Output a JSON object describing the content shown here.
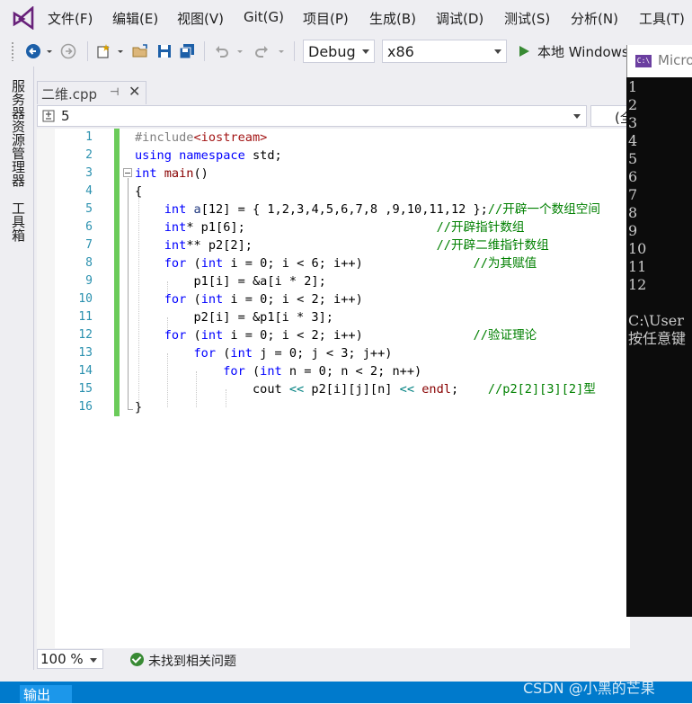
{
  "menubar": {
    "items": [
      "文件(F)",
      "编辑(E)",
      "视图(V)",
      "Git(G)",
      "项目(P)",
      "生成(B)",
      "调试(D)",
      "测试(S)",
      "分析(N)",
      "工具(T)"
    ]
  },
  "toolbar": {
    "configuration": "Debug",
    "platform": "x86",
    "run_label": "本地 Windows"
  },
  "side_tabs": [
    "服务器资源管理器",
    "工具箱"
  ],
  "tab": {
    "title": "二维.cpp",
    "pin": "⊣",
    "close": "✕"
  },
  "navbar": {
    "scope": "5",
    "member": "(全"
  },
  "editor": {
    "line_numbers": [
      "1",
      "2",
      "3",
      "4",
      "5",
      "6",
      "7",
      "8",
      "9",
      "10",
      "11",
      "12",
      "13",
      "14",
      "15",
      "16"
    ],
    "lines": [
      [
        {
          "t": "#include",
          "c": "pp"
        },
        {
          "t": "<iostream>",
          "c": "inc"
        }
      ],
      [
        {
          "t": "using",
          "c": "kw"
        },
        {
          "t": " ",
          "c": "pl"
        },
        {
          "t": "namespace",
          "c": "kw"
        },
        {
          "t": " std;",
          "c": "pl"
        }
      ],
      [
        {
          "t": "int",
          "c": "kw"
        },
        {
          "t": " ",
          "c": "pl"
        },
        {
          "t": "main",
          "c": "fn"
        },
        {
          "t": "()",
          "c": "pl"
        }
      ],
      [
        {
          "t": "{",
          "c": "pl"
        }
      ],
      [
        {
          "t": "    ",
          "c": "pl"
        },
        {
          "t": "int",
          "c": "kw"
        },
        {
          "t": " ",
          "c": "pl"
        },
        {
          "t": "a",
          "c": "var"
        },
        {
          "t": "[12] = { 1,2,3,4,5,6,7,8 ,9,10,11,12 };",
          "c": "pl"
        },
        {
          "t": "//开辟一个数组空间",
          "c": "cm"
        }
      ],
      [
        {
          "t": "    ",
          "c": "pl"
        },
        {
          "t": "int",
          "c": "kw"
        },
        {
          "t": "* p1[6];",
          "c": "pl"
        },
        {
          "t": "                          ",
          "c": "pl"
        },
        {
          "t": "//开辟指针数组",
          "c": "cm"
        }
      ],
      [
        {
          "t": "    ",
          "c": "pl"
        },
        {
          "t": "int",
          "c": "kw"
        },
        {
          "t": "** p2[2];",
          "c": "pl"
        },
        {
          "t": "                         ",
          "c": "pl"
        },
        {
          "t": "//开辟二维指针数组",
          "c": "cm"
        }
      ],
      [
        {
          "t": "    ",
          "c": "pl"
        },
        {
          "t": "for",
          "c": "kw"
        },
        {
          "t": " (",
          "c": "pl"
        },
        {
          "t": "int",
          "c": "kw"
        },
        {
          "t": " i = 0; i < 6; i++)",
          "c": "pl"
        },
        {
          "t": "               ",
          "c": "pl"
        },
        {
          "t": "//为其赋值",
          "c": "cm"
        }
      ],
      [
        {
          "t": "        p1[i] = &a[i * 2];",
          "c": "pl"
        }
      ],
      [
        {
          "t": "    ",
          "c": "pl"
        },
        {
          "t": "for",
          "c": "kw"
        },
        {
          "t": " (",
          "c": "pl"
        },
        {
          "t": "int",
          "c": "kw"
        },
        {
          "t": " i = 0; i < 2; i++)",
          "c": "pl"
        }
      ],
      [
        {
          "t": "        p2[i] = &p1[i * 3];",
          "c": "pl"
        }
      ],
      [
        {
          "t": "    ",
          "c": "pl"
        },
        {
          "t": "for",
          "c": "kw"
        },
        {
          "t": " (",
          "c": "pl"
        },
        {
          "t": "int",
          "c": "kw"
        },
        {
          "t": " i = 0; i < 2; i++)",
          "c": "pl"
        },
        {
          "t": "               ",
          "c": "pl"
        },
        {
          "t": "//验证理论",
          "c": "cm"
        }
      ],
      [
        {
          "t": "        ",
          "c": "pl"
        },
        {
          "t": "for",
          "c": "kw"
        },
        {
          "t": " (",
          "c": "pl"
        },
        {
          "t": "int",
          "c": "kw"
        },
        {
          "t": " j = 0; j < 3; j++)",
          "c": "pl"
        }
      ],
      [
        {
          "t": "            ",
          "c": "pl"
        },
        {
          "t": "for",
          "c": "kw"
        },
        {
          "t": " (",
          "c": "pl"
        },
        {
          "t": "int",
          "c": "kw"
        },
        {
          "t": " n = 0; n < 2; n++)",
          "c": "pl"
        }
      ],
      [
        {
          "t": "                cout ",
          "c": "pl"
        },
        {
          "t": "<<",
          "c": "op"
        },
        {
          "t": " p2[i][j][n] ",
          "c": "pl"
        },
        {
          "t": "<<",
          "c": "op"
        },
        {
          "t": " ",
          "c": "pl"
        },
        {
          "t": "endl",
          "c": "fn"
        },
        {
          "t": ";    ",
          "c": "pl"
        },
        {
          "t": "//p2[2][3][2]型",
          "c": "cm"
        }
      ],
      [
        {
          "t": "}",
          "c": "pl"
        }
      ]
    ]
  },
  "statusbar": {
    "zoom": "100 %",
    "issues": "未找到相关问题"
  },
  "output_tab": "输出",
  "watermark": "CSDN @小黑的芒果",
  "console": {
    "title": "Micro",
    "icon_text": "C:\\",
    "lines": [
      "1",
      "2",
      "3",
      "4",
      "5",
      "6",
      "7",
      "8",
      "9",
      "10",
      "11",
      "12",
      "",
      "C:\\User",
      "按任意键"
    ]
  }
}
